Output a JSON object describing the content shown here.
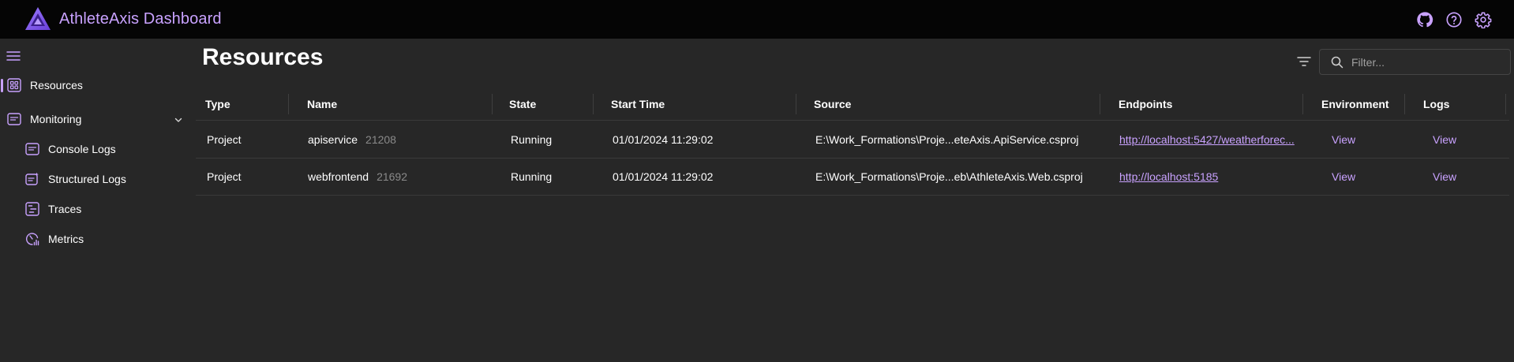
{
  "header": {
    "title": "AthleteAxis Dashboard",
    "icons": [
      "github-icon",
      "help-icon",
      "settings-icon"
    ]
  },
  "sidebar": {
    "items": [
      {
        "label": "Resources",
        "icon": "resources-icon",
        "active": true
      },
      {
        "label": "Monitoring",
        "icon": "monitoring-icon",
        "expanded": true
      },
      {
        "label": "Console Logs",
        "icon": "console-logs-icon"
      },
      {
        "label": "Structured Logs",
        "icon": "structured-logs-icon"
      },
      {
        "label": "Traces",
        "icon": "traces-icon"
      },
      {
        "label": "Metrics",
        "icon": "metrics-icon"
      }
    ]
  },
  "main": {
    "title": "Resources",
    "search": {
      "placeholder": "Filter...",
      "value": ""
    }
  },
  "table": {
    "columns": [
      "Type",
      "Name",
      "State",
      "Start Time",
      "Source",
      "Endpoints",
      "Environment",
      "Logs"
    ],
    "rows": [
      {
        "type": "Project",
        "name": "apiservice",
        "pid": "21208",
        "state": "Running",
        "start_time": "01/01/2024 11:29:02",
        "source": "E:\\Work_Formations\\Proje...eteAxis.ApiService.csproj",
        "endpoint": "http://localhost:5427/weatherforec...",
        "environment": "View",
        "logs": "View"
      },
      {
        "type": "Project",
        "name": "webfrontend",
        "pid": "21692",
        "state": "Running",
        "start_time": "01/01/2024 11:29:02",
        "source": "E:\\Work_Formations\\Proje...eb\\AthleteAxis.Web.csproj",
        "endpoint": "http://localhost:5185",
        "environment": "View",
        "logs": "View"
      }
    ]
  },
  "colors": {
    "accent": "#c9a2ff",
    "header_bg": "#050505",
    "page_bg": "#272727",
    "muted": "#8a8a8a"
  }
}
